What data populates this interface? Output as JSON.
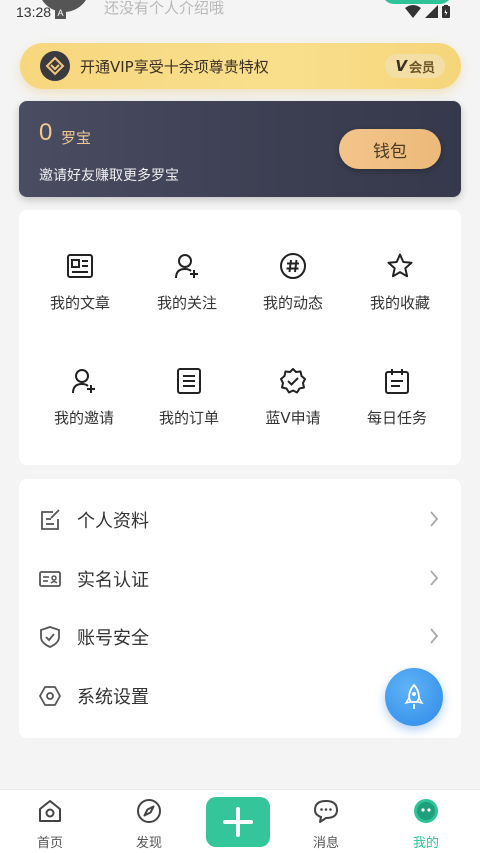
{
  "status_bar": {
    "time": "13:28",
    "notif_letter": "A"
  },
  "profile": {
    "bio": "还没有个人介绍哦"
  },
  "vip_banner": {
    "text": "开通VIP享受十余项尊贵特权",
    "badge_mark": "V",
    "badge_label": "会员"
  },
  "wallet": {
    "amount": "0",
    "unit": "罗宝",
    "subtitle": "邀请好友赚取更多罗宝",
    "button": "钱包"
  },
  "grid": {
    "items": [
      {
        "label": "我的文章",
        "icon": "article-icon"
      },
      {
        "label": "我的关注",
        "icon": "follow-icon"
      },
      {
        "label": "我的动态",
        "icon": "hashtag-icon"
      },
      {
        "label": "我的收藏",
        "icon": "star-icon"
      },
      {
        "label": "我的邀请",
        "icon": "invite-icon"
      },
      {
        "label": "我的订单",
        "icon": "order-icon"
      },
      {
        "label": "蓝V申请",
        "icon": "verified-badge-icon"
      },
      {
        "label": "每日任务",
        "icon": "calendar-icon"
      }
    ]
  },
  "menu": {
    "items": [
      {
        "label": "个人资料",
        "icon": "edit-profile-icon"
      },
      {
        "label": "实名认证",
        "icon": "id-card-icon"
      },
      {
        "label": "账号安全",
        "icon": "shield-icon"
      },
      {
        "label": "系统设置",
        "icon": "settings-icon"
      }
    ]
  },
  "bottom_nav": {
    "items": [
      {
        "label": "首页",
        "icon": "home-icon"
      },
      {
        "label": "发现",
        "icon": "compass-icon"
      },
      {
        "label": "消息",
        "icon": "message-icon"
      },
      {
        "label": "我的",
        "icon": "me-icon"
      }
    ]
  },
  "colors": {
    "accent": "#2fc39a",
    "fab": "#2f8ae8",
    "wallet_bg": "#3c3f52",
    "gold": "#f1c891"
  }
}
